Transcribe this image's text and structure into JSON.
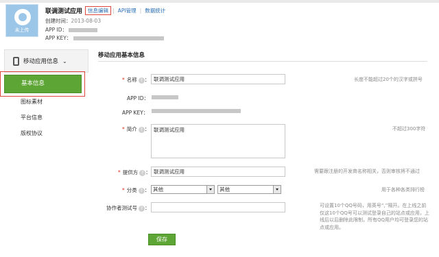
{
  "app": {
    "icon_text": "未上传",
    "name": "联调测试应用",
    "header_links": [
      "信息编辑",
      "API管理",
      "数据统计"
    ],
    "created_label": "创建时间：",
    "created_value": "2013-08-03",
    "app_id_label": "APP ID：",
    "app_key_label": "APP KEY："
  },
  "sidebar": {
    "section_label": "移动应用信息",
    "items": [
      {
        "label": "基本信息",
        "active": true
      },
      {
        "label": "图标素材",
        "active": false
      },
      {
        "label": "平台信息",
        "active": false
      },
      {
        "label": "版权协议",
        "active": false
      }
    ]
  },
  "panel": {
    "title": "移动应用基本信息",
    "name_label": "名称",
    "name_value": "联调测试应用",
    "name_hint": "长度不能超过20个的汉字或拼号",
    "app_id_label": "APP ID：",
    "app_key_label": "APP KEY：",
    "intro_label": "简介",
    "intro_value": "联调测试应用",
    "intro_hint": "不超过300字符",
    "provider_label": "提供方",
    "provider_value": "联调测试应用",
    "provider_hint": "需要跟注册的开发商名称相关，否则审核将不通过",
    "category_label": "分类",
    "category_primary": "其他",
    "category_secondary": "其他",
    "category_hint": "用于各种各类排行榜",
    "tester_label": "协作者测试号",
    "tester_value": "",
    "tester_hint": "可设置10个QQ号码，用英号“,”隔开。在上线之前仅这10个QQ号可以测试登录自己的站点或应用，上线后以后删除此限制，所有QQ用户均可登录您的站点或应用。",
    "save_label": "保存"
  },
  "colors": {
    "accent_green": "#5da534",
    "link_blue": "#2b6fb6",
    "highlight_red": "#e0473d"
  }
}
